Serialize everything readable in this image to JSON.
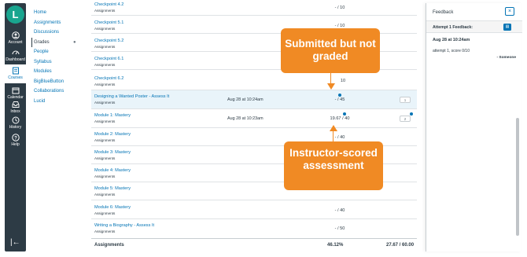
{
  "global_nav": {
    "logo": "L",
    "items": [
      {
        "label": "Account",
        "icon": "account-icon"
      },
      {
        "label": "Dashboard",
        "icon": "dashboard-icon"
      },
      {
        "label": "Courses",
        "icon": "courses-icon"
      },
      {
        "label": "Calendar",
        "icon": "calendar-icon"
      },
      {
        "label": "Inbox",
        "icon": "inbox-icon"
      },
      {
        "label": "History",
        "icon": "history-icon"
      },
      {
        "label": "Help",
        "icon": "help-icon"
      }
    ],
    "collapse_icon": "collapse-icon",
    "collapse_glyph": "|←"
  },
  "course_nav": {
    "items": [
      "Home",
      "Assignments",
      "Discussions",
      "Grades",
      "People",
      "Syllabus",
      "Modules",
      "BigBlueButton",
      "Collaborations",
      "Lucid"
    ],
    "active": "Grades"
  },
  "grades": {
    "rows": [
      {
        "name": "Checkpoint 4.2",
        "type": "Assignments",
        "submitted": "",
        "score": "- / 10",
        "comment": ""
      },
      {
        "name": "Checkpoint 5.1",
        "type": "Assignments",
        "submitted": "",
        "score": "- / 10",
        "comment": ""
      },
      {
        "name": "Checkpoint 5.2",
        "type": "Assignments",
        "submitted": "",
        "score": "",
        "comment": ""
      },
      {
        "name": "Checkpoint 6.1",
        "type": "Assignments",
        "submitted": "",
        "score": "",
        "comment": ""
      },
      {
        "name": "Checkpoint 6.2",
        "type": "Assignments",
        "submitted": "",
        "score": "10",
        "comment": ""
      },
      {
        "name": "Designing a Wanted Poster - Assess It",
        "type": "Assignments",
        "submitted": "Aug 28 at 10:24am",
        "score": "- / 45",
        "comment": "1"
      },
      {
        "name": "Module 1: Mastery",
        "type": "Assignments",
        "submitted": "Aug 28 at 10:23am",
        "score": "19.67 / 40",
        "comment": "2"
      },
      {
        "name": "Module 2: Mastery",
        "type": "Assignments",
        "submitted": "",
        "score": "- / 40",
        "comment": ""
      },
      {
        "name": "Module 3: Mastery",
        "type": "Assignments",
        "submitted": "",
        "score": "",
        "comment": ""
      },
      {
        "name": "Module 4: Mastery",
        "type": "Assignments",
        "submitted": "",
        "score": "",
        "comment": ""
      },
      {
        "name": "Module 5: Mastery",
        "type": "Assignments",
        "submitted": "",
        "score": "",
        "comment": ""
      },
      {
        "name": "Module 6: Mastery",
        "type": "Assignments",
        "submitted": "",
        "score": "- / 40",
        "comment": ""
      },
      {
        "name": "Writing a Biography - Assess It",
        "type": "Assignments",
        "submitted": "",
        "score": "- / 50",
        "comment": ""
      }
    ],
    "total": {
      "label": "Assignments",
      "percent": "46.12%",
      "points": "27.67 / 60.00"
    }
  },
  "feedback": {
    "title": "Feedback",
    "close_icon": "close-icon",
    "close_glyph": "×",
    "attempt_header": "Attempt 1 Feedback:",
    "date": "Aug 28 at 10:24am",
    "attempt_text": "attempt 1, score 0/10",
    "author": "- Someone"
  },
  "callouts": {
    "submitted": "Submitted but not graded",
    "instructor": "Instructor-scored assessment",
    "color": "#f08a24"
  },
  "colors": {
    "nav_bg": "#2d3b45",
    "link": "#0374b5",
    "highlight_row": "#e9f4fa",
    "logo": "#19a58f"
  }
}
